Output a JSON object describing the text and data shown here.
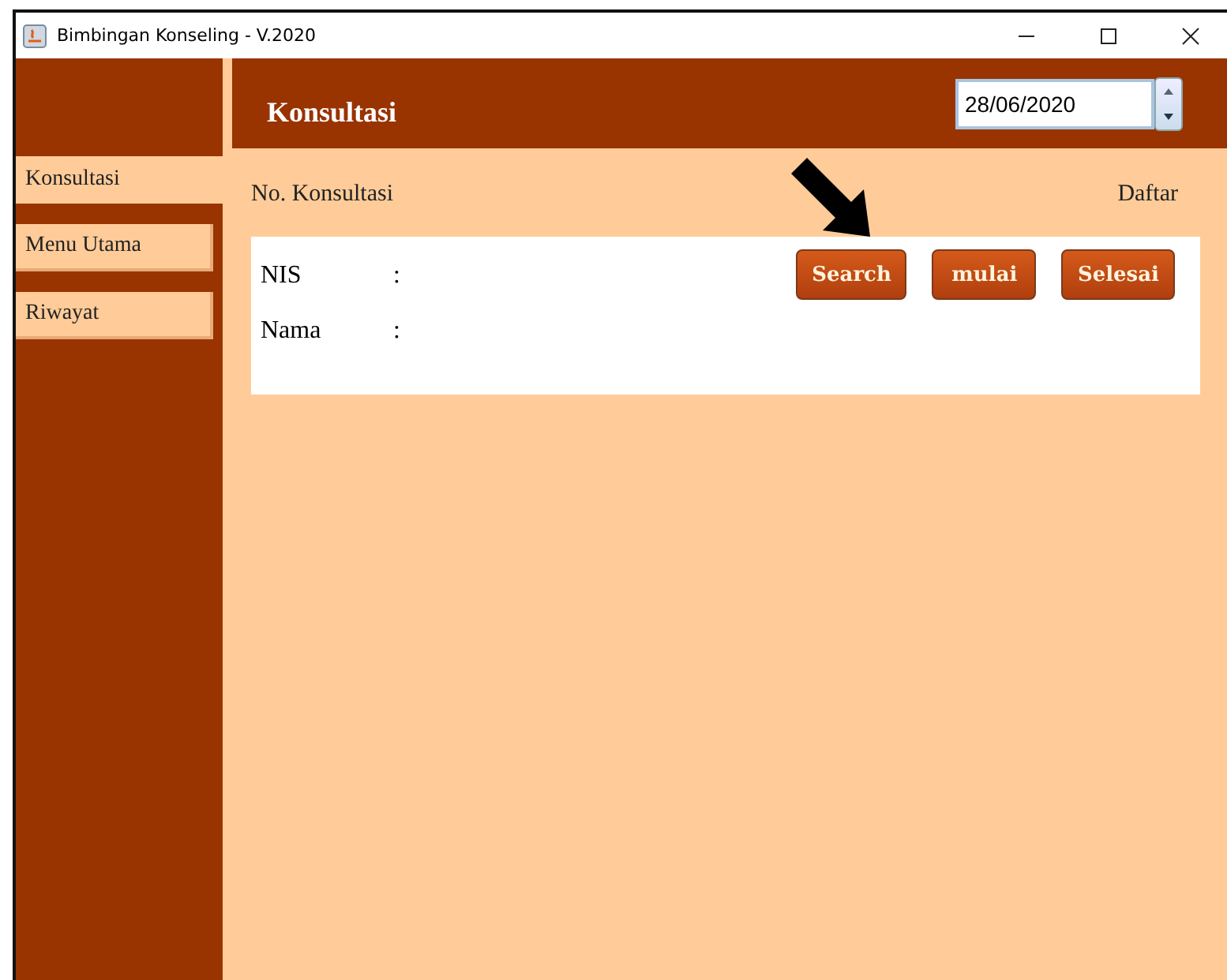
{
  "window": {
    "title": "Bimbingan Konseling - V.2020"
  },
  "sidebar": {
    "items": [
      {
        "label": "Konsultasi",
        "selected": true
      },
      {
        "label": "Menu Utama",
        "selected": false
      },
      {
        "label": "Riwayat",
        "selected": false
      }
    ]
  },
  "header": {
    "title": "Konsultasi",
    "date": "28/06/2020"
  },
  "form": {
    "number_label": "No. Konsultasi",
    "list_link": "Daftar",
    "fields": [
      {
        "label": "NIS",
        "separator": ":"
      },
      {
        "label": "Nama",
        "separator": ":"
      }
    ],
    "buttons": [
      "Search",
      "mulai",
      "Selesai"
    ]
  }
}
